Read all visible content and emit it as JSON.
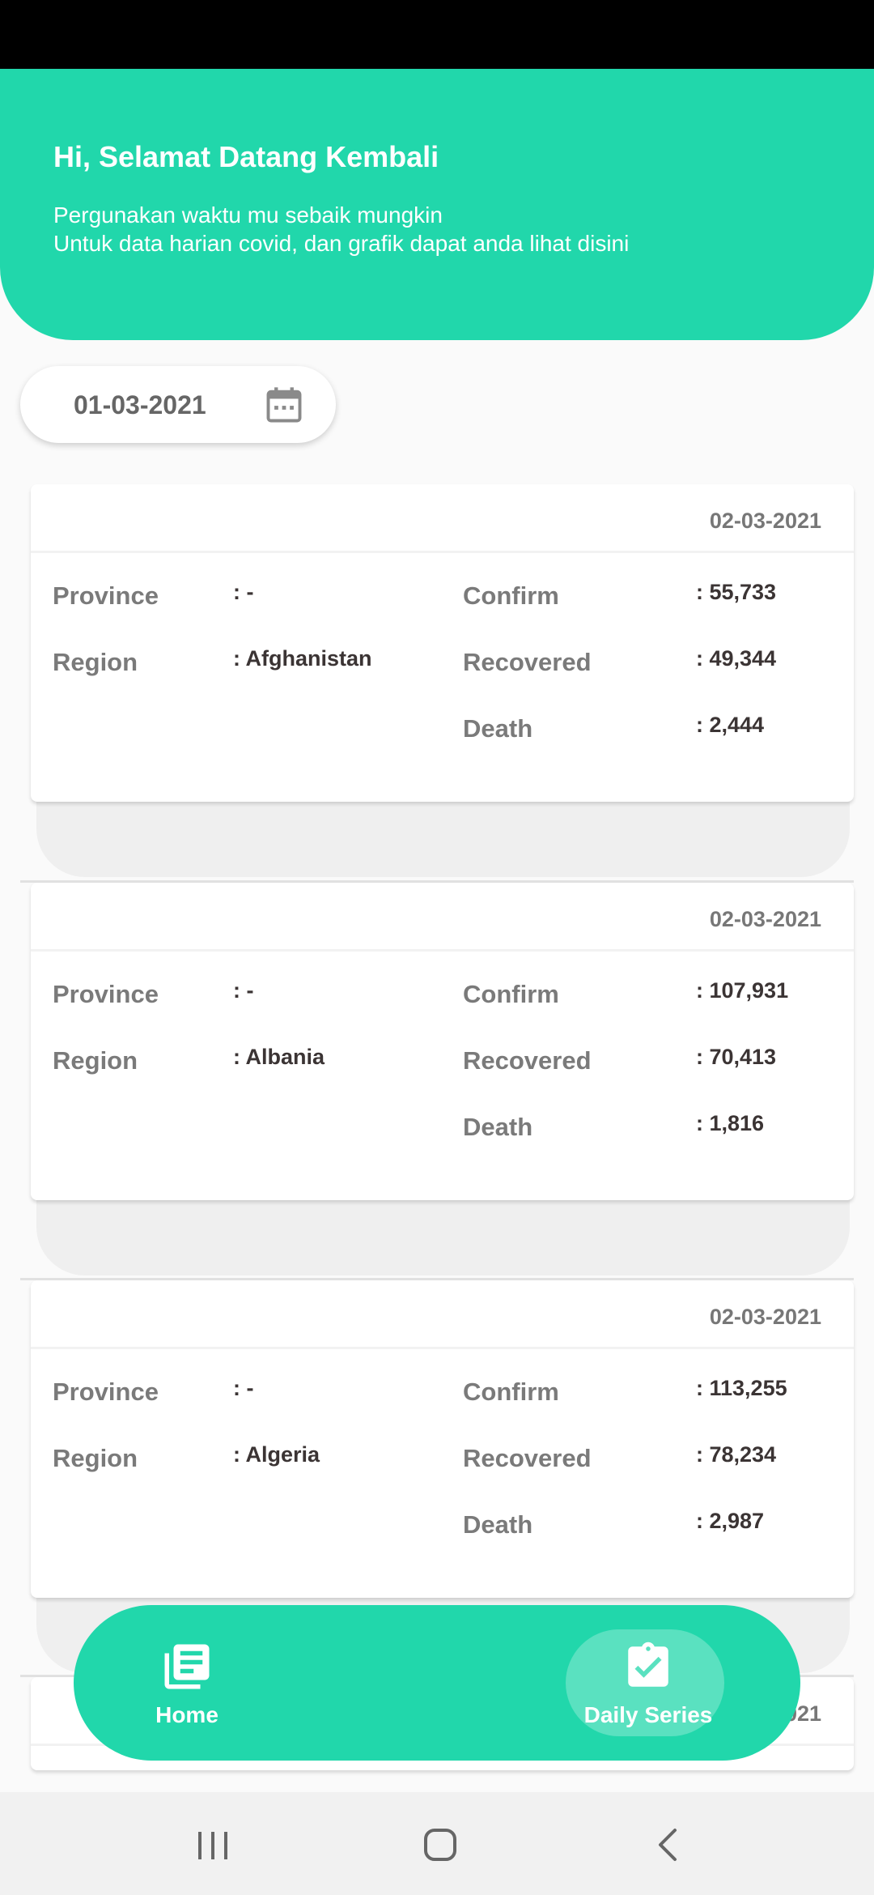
{
  "header": {
    "title": "Hi, Selamat Datang Kembali",
    "subtitle_line1": "Pergunakan waktu mu sebaik mungkin",
    "subtitle_line2": "Untuk data harian covid, dan grafik dapat anda lihat disini"
  },
  "date_picker": {
    "value": "01-03-2021",
    "icon": "calendar-icon"
  },
  "labels": {
    "province": "Province",
    "region": "Region",
    "confirm": "Confirm",
    "recovered": "Recovered",
    "death": "Death"
  },
  "cards": [
    {
      "date": "02-03-2021",
      "province": ": -",
      "region": ": Afghanistan",
      "confirm": ": 55,733",
      "recovered": ": 49,344",
      "death": ": 2,444"
    },
    {
      "date": "02-03-2021",
      "province": ": -",
      "region": ": Albania",
      "confirm": ": 107,931",
      "recovered": ": 70,413",
      "death": ": 1,816"
    },
    {
      "date": "02-03-2021",
      "province": ": -",
      "region": ": Algeria",
      "confirm": ": 113,255",
      "recovered": ": 78,234",
      "death": ": 2,987"
    },
    {
      "date": "02-03-2021"
    }
  ],
  "bottom_nav": {
    "home_label": "Home",
    "daily_label": "Daily Series",
    "home_icon": "library-icon",
    "daily_icon": "clipboard-check-icon"
  },
  "colors": {
    "primary": "#21d7ab",
    "text_label": "#7a7a7a",
    "text_value": "#3b3434"
  }
}
